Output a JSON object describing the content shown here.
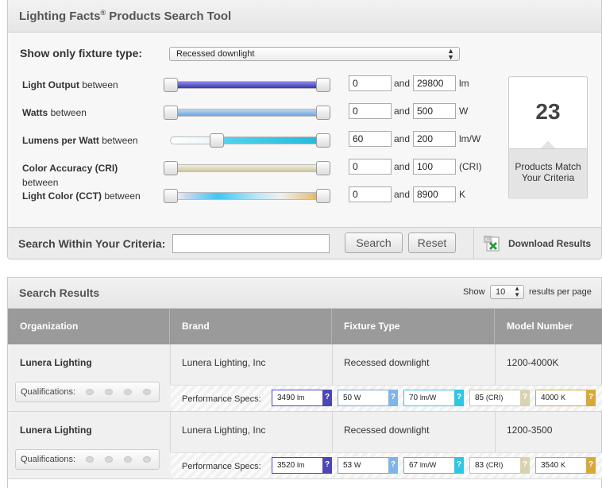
{
  "tool": {
    "title": "Lighting Facts",
    "title_mark": "®",
    "title_rest": " Products Search Tool"
  },
  "fixture": {
    "label": "Show only fixture type:",
    "value": "Recessed downlight"
  },
  "filters": [
    {
      "label_bold": "Light Output",
      "label_rest": " between",
      "label_extra": "",
      "min": "0",
      "max": "29800",
      "unit": "lm",
      "low": 0.0,
      "high": 1.0
    },
    {
      "label_bold": "Watts",
      "label_rest": " between",
      "label_extra": "",
      "min": "0",
      "max": "500",
      "unit": "W",
      "low": 0.0,
      "high": 1.0
    },
    {
      "label_bold": "Lumens per Watt",
      "label_rest": " between",
      "label_extra": "",
      "min": "60",
      "max": "200",
      "unit": "lm/W",
      "low": 0.3,
      "high": 1.0
    },
    {
      "label_bold": "Color Accuracy (CRI)",
      "label_rest": "",
      "label_extra": "between",
      "min": "0",
      "max": "100",
      "unit": "(CRI)",
      "low": 0.0,
      "high": 1.0
    },
    {
      "label_bold": "Light Color (CCT)",
      "label_rest": " between",
      "label_extra": "",
      "min": "0",
      "max": "8900",
      "unit": "K",
      "low": 0.0,
      "high": 1.0
    }
  ],
  "and_label": "and",
  "count": {
    "value": "23",
    "text_line1": "Products Match",
    "text_line2": "Your Criteria"
  },
  "search": {
    "label": "Search Within Your Criteria:",
    "placeholder": "",
    "search_button": "Search",
    "reset_button": "Reset",
    "download_label": "Download Results",
    "download_icon": "excel-icon"
  },
  "results": {
    "title": "Search Results",
    "show_label": "Show",
    "per_page": "10",
    "per_page_label": "results per page",
    "columns": [
      "Organization",
      "Brand",
      "Fixture Type",
      "Model Number"
    ],
    "qualifications_label": "Qualifications:",
    "performance_label": "Performance Specs:",
    "rows": [
      {
        "organization": "Lunera Lighting",
        "brand": "Lunera Lighting, Inc",
        "fixture_type": "Recessed downlight",
        "model": "1200-4000K",
        "specs": [
          {
            "value": "3490",
            "unit": "lm"
          },
          {
            "value": "50",
            "unit": "W"
          },
          {
            "value": "70",
            "unit": "lm/W"
          },
          {
            "value": "85",
            "unit": "(CRI)"
          },
          {
            "value": "4000",
            "unit": "K"
          }
        ]
      },
      {
        "organization": "Lunera Lighting",
        "brand": "Lunera Lighting, Inc",
        "fixture_type": "Recessed downlight",
        "model": "1200-3500",
        "specs": [
          {
            "value": "3520",
            "unit": "lm"
          },
          {
            "value": "53",
            "unit": "W"
          },
          {
            "value": "67",
            "unit": "lm/W"
          },
          {
            "value": "83",
            "unit": "(CRI)"
          },
          {
            "value": "3540",
            "unit": "K"
          }
        ]
      }
    ]
  },
  "spec_help": "?",
  "colors": {
    "lm": "#4b47b8",
    "w": "#7fb4e6",
    "lmw": "#2fc6e3",
    "cri": "#d8d2b0",
    "k": "#d6a93a"
  }
}
